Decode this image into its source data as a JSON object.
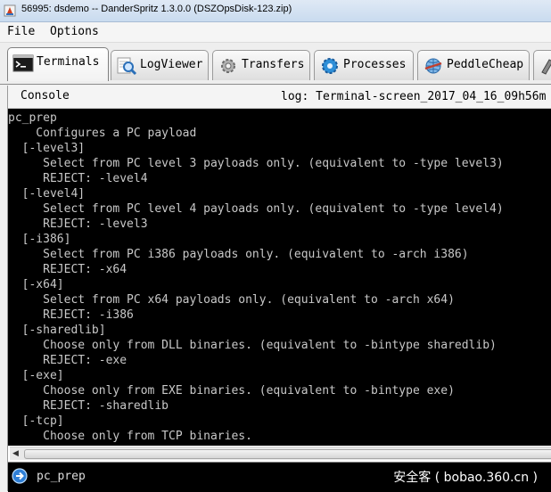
{
  "window": {
    "title": "56995: dsdemo -- DanderSpritz 1.3.0.0 (DSZOpsDisk-123.zip)"
  },
  "menu": {
    "items": [
      "File",
      "Options"
    ]
  },
  "tabs": [
    {
      "label": "Terminals",
      "icon": "terminal-icon",
      "active": true
    },
    {
      "label": "LogViewer",
      "icon": "magnifier-icon",
      "active": false
    },
    {
      "label": "Transfers",
      "icon": "gear-icon",
      "active": false
    },
    {
      "label": "Processes",
      "icon": "gears-icon",
      "active": false
    },
    {
      "label": "PeddleCheap",
      "icon": "globe-icon",
      "active": false
    }
  ],
  "console": {
    "label": "Console",
    "log": "log: Terminal-screen_2017_04_16_09h56m"
  },
  "terminal": {
    "lines": [
      "pc_prep",
      "    Configures a PC payload",
      "  [-level3]",
      "     Select from PC level 3 payloads only. (equivalent to -type level3)",
      "     REJECT: -level4",
      "  [-level4]",
      "     Select from PC level 4 payloads only. (equivalent to -type level4)",
      "     REJECT: -level3",
      "  [-i386]",
      "     Select from PC i386 payloads only. (equivalent to -arch i386)",
      "     REJECT: -x64",
      "  [-x64]",
      "     Select from PC x64 payloads only. (equivalent to -arch x64)",
      "     REJECT: -i386",
      "  [-sharedlib]",
      "     Choose only from DLL binaries. (equivalent to -bintype sharedlib)",
      "     REJECT: -exe",
      "  [-exe]",
      "     Choose only from EXE binaries. (equivalent to -bintype exe)",
      "     REJECT: -sharedlib",
      "  [-tcp]",
      "     Choose only from TCP binaries."
    ]
  },
  "input": {
    "value": "pc_prep"
  },
  "watermark": "安全客 ( bobao.360.cn )"
}
